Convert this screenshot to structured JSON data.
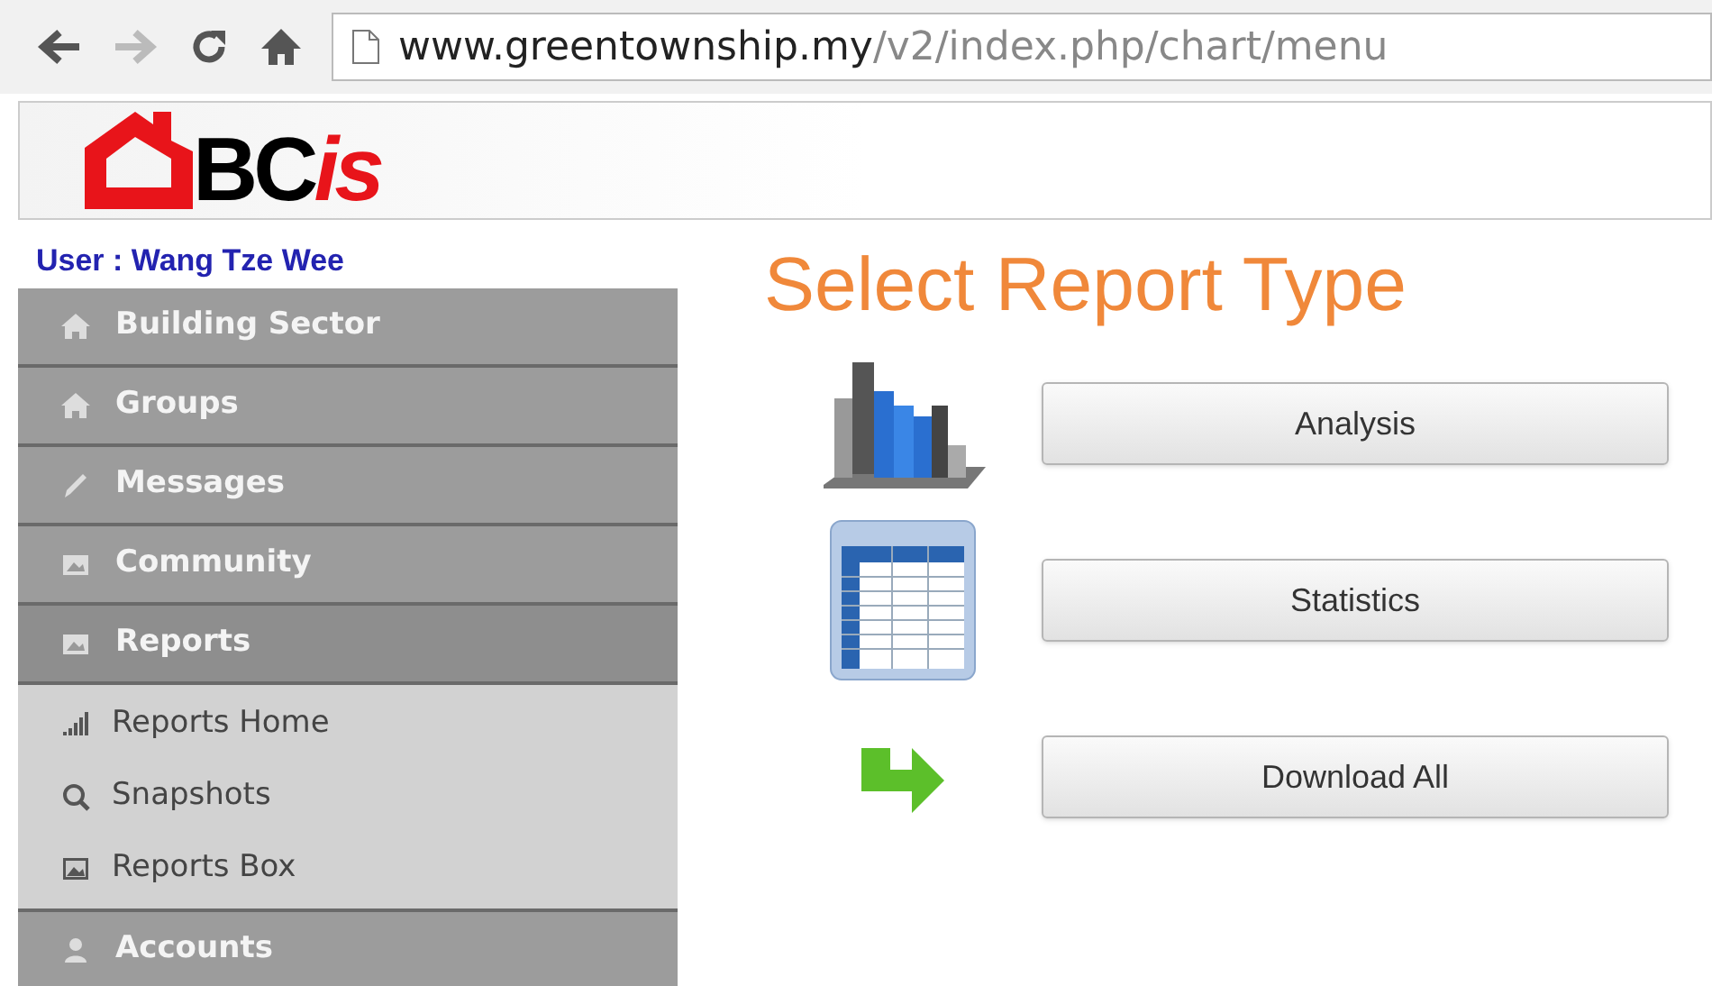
{
  "browser": {
    "url_host": "www.greentownship.my",
    "url_path": "/v2/index.php/chart/menu"
  },
  "logo": {
    "main": "BC",
    "accent": "is"
  },
  "user_label": "User : Wang Tze Wee",
  "sidebar": {
    "items": [
      {
        "label": "Building Sector",
        "expanded": false
      },
      {
        "label": "Groups",
        "expanded": false
      },
      {
        "label": "Messages",
        "expanded": false
      },
      {
        "label": "Community",
        "expanded": false
      },
      {
        "label": "Reports",
        "expanded": true,
        "children": [
          {
            "label": "Reports Home"
          },
          {
            "label": "Snapshots"
          },
          {
            "label": "Reports Box"
          }
        ]
      },
      {
        "label": "Accounts",
        "expanded": false
      }
    ]
  },
  "title": "Select Report Type",
  "report_types": [
    {
      "label": "Analysis"
    },
    {
      "label": "Statistics"
    },
    {
      "label": "Download All"
    }
  ]
}
